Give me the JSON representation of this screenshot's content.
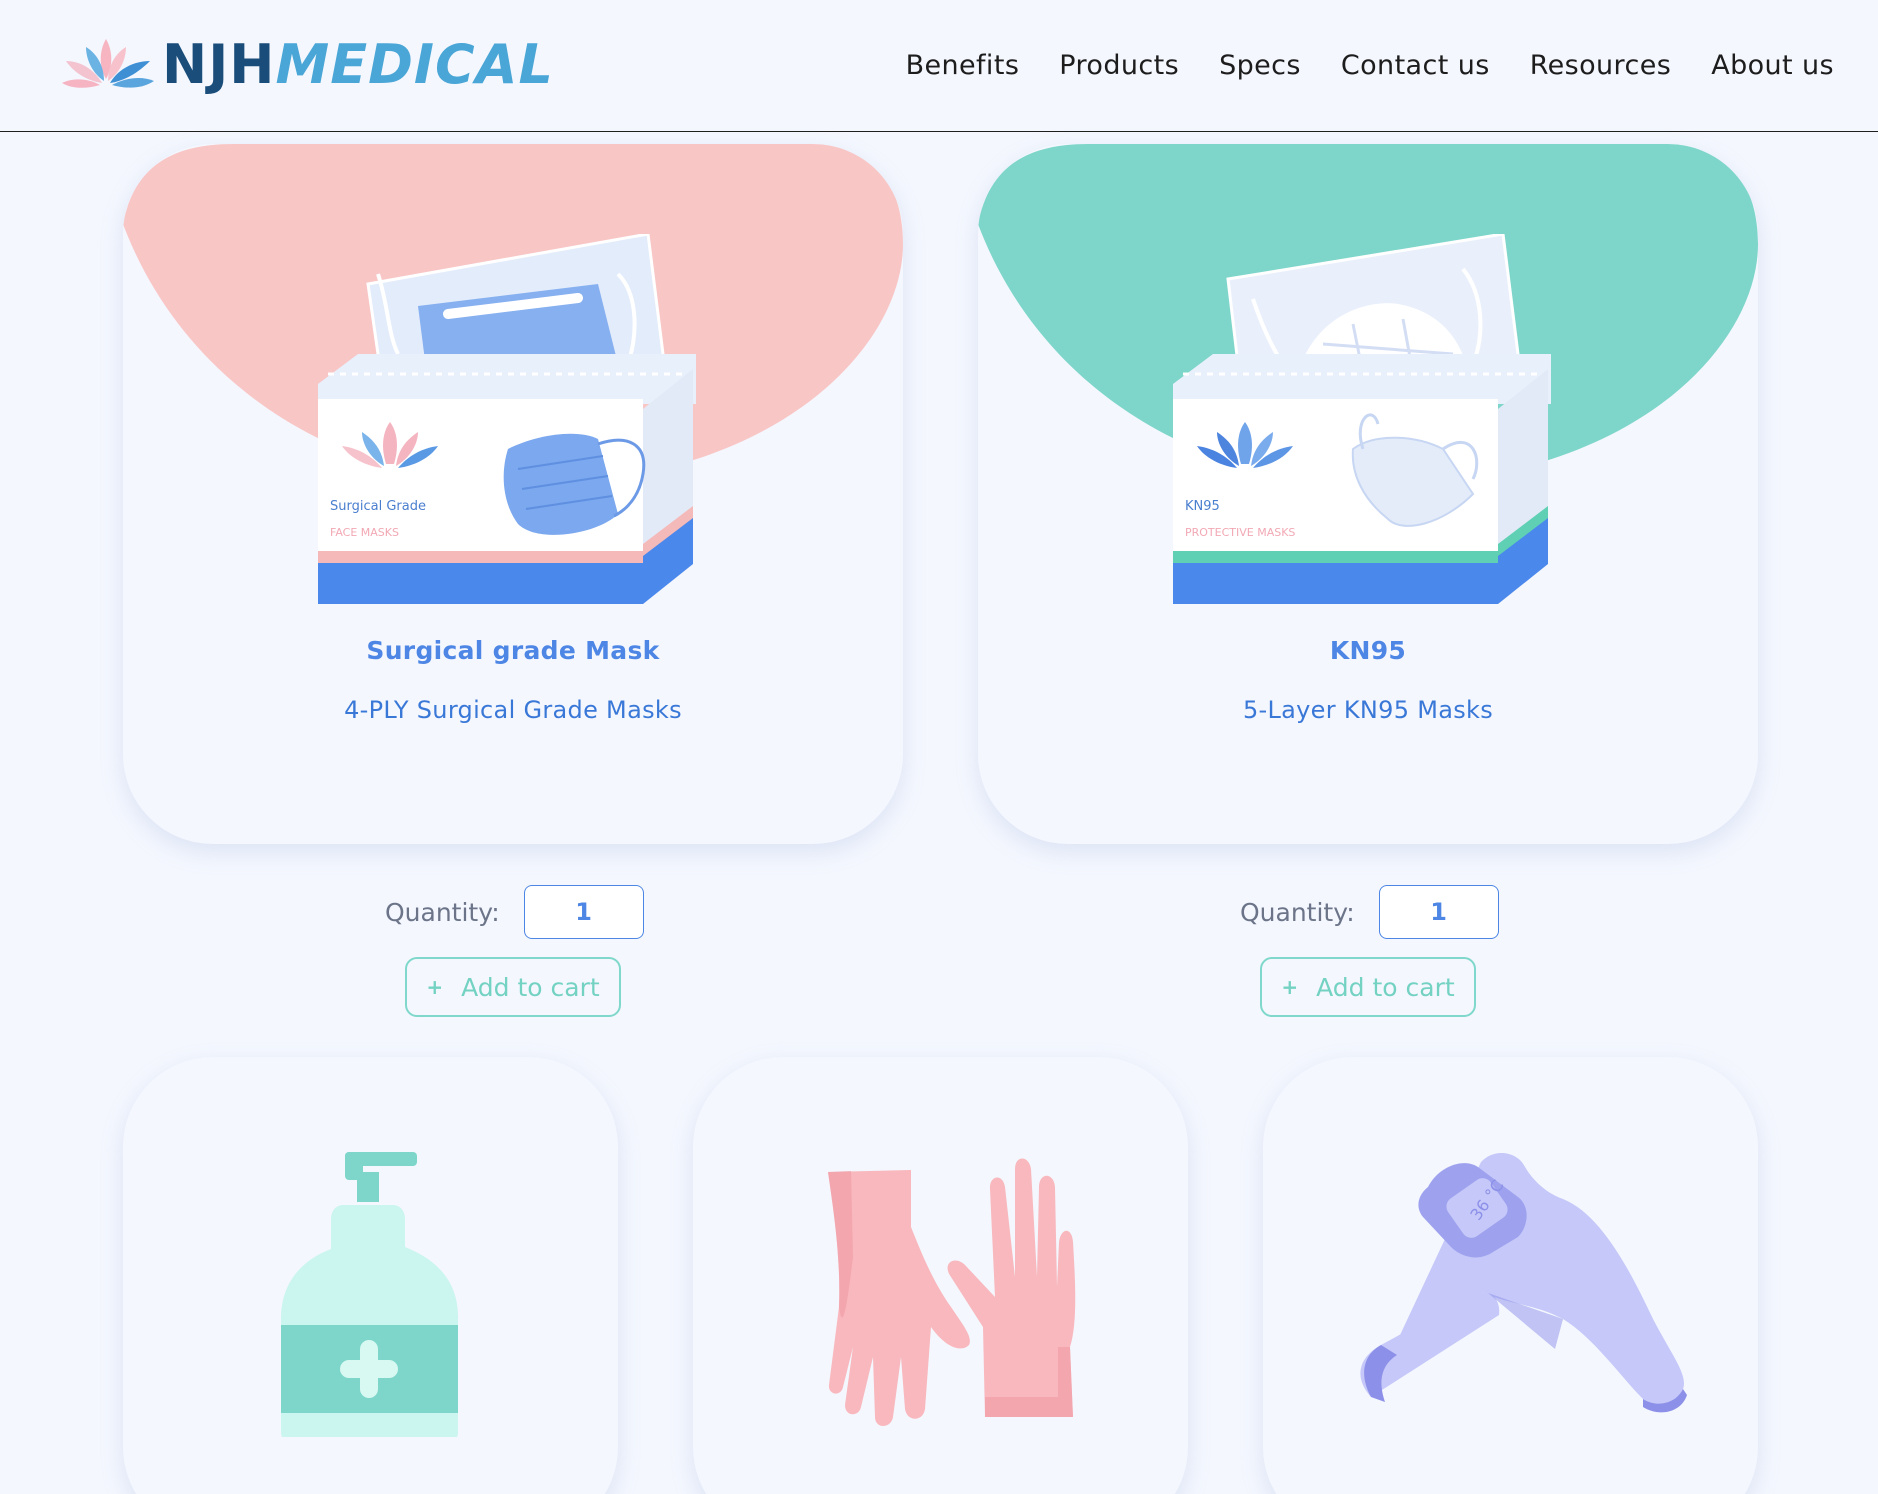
{
  "header": {
    "logo": {
      "part1": "NJH",
      "part2": "MEDICAL"
    },
    "nav": [
      "Benefits",
      "Products",
      "Specs",
      "Contact us",
      "Resources",
      "About us"
    ]
  },
  "products": [
    {
      "title": "Surgical grade Mask",
      "subtitle": "4-PLY Surgical Grade Masks",
      "box_line1": "Surgical Grade",
      "box_line2": "FACE MASKS",
      "quantity_label": "Quantity:",
      "quantity": "1",
      "button": "Add to cart",
      "accent": "#f9c6c6"
    },
    {
      "title": "KN95",
      "subtitle": "5-Layer KN95 Masks",
      "box_line1": "KN95",
      "box_line2": "PROTECTIVE MASKS",
      "quantity_label": "Quantity:",
      "quantity": "1",
      "button": "Add to cart",
      "accent": "#7ed6ca"
    }
  ],
  "more_products": [
    {
      "icon": "sanitizer-bottle-icon"
    },
    {
      "icon": "gloves-icon"
    },
    {
      "icon": "thermometer-gun-icon",
      "display": "36 °C"
    }
  ],
  "colors": {
    "background": "#f4f7fe",
    "primary_blue": "#4d86e4",
    "teal": "#7ed6ca",
    "pink": "#f9c6c6",
    "lavender": "#c4c8f7"
  }
}
